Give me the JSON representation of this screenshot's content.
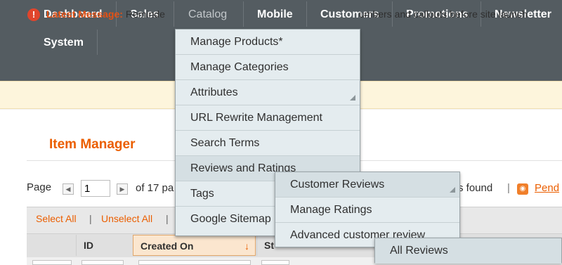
{
  "nav": {
    "items": [
      "Dashboard",
      "Sales",
      "Catalog",
      "Mobile",
      "Customers",
      "Promotions",
      "Newsletter",
      "System"
    ]
  },
  "message": {
    "icon": "alert-icon",
    "strong": "Latest Message:",
    "left_text": "Reminde",
    "right_text": "umbers and callouts before site launch"
  },
  "page_title": "Item Manager",
  "pager": {
    "page_label": "Page",
    "page_value": "1",
    "of_text": "of 17 pa",
    "found_text": "s found",
    "separator": "|",
    "pending_link": "Pend"
  },
  "selection": {
    "select_all": "Select All",
    "unselect_all": "Unselect All",
    "pipe": "|"
  },
  "table": {
    "columns": [
      "ID",
      "Created On",
      "St"
    ],
    "sort_indicator": "↓"
  },
  "catalog_menu": {
    "items": [
      "Manage Products*",
      "Manage Categories",
      "Attributes",
      "URL Rewrite Management",
      "Search Terms",
      "Reviews and Ratings",
      "Tags",
      "Google Sitemap"
    ]
  },
  "reviews_menu": {
    "items": [
      "Customer Reviews",
      "Manage Ratings",
      "Advanced customer review"
    ]
  },
  "customer_reviews_menu": {
    "items": [
      "All Reviews"
    ]
  },
  "colors": {
    "nav_bg": "#545c61",
    "accent": "#eb5e00",
    "menu_bg": "#e4ecef"
  }
}
